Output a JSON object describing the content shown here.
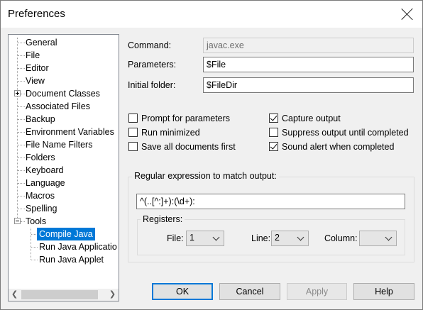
{
  "window": {
    "title": "Preferences"
  },
  "tree": {
    "items": [
      "General",
      "File",
      "Editor",
      "View",
      "Document Classes",
      "Associated Files",
      "Backup",
      "Environment Variables",
      "File Name Filters",
      "Folders",
      "Keyboard",
      "Language",
      "Macros",
      "Spelling",
      "Tools",
      "Compile Java",
      "Run Java Applicatio",
      "Run Java Applet"
    ],
    "selected": "Compile Java"
  },
  "form": {
    "command_label": "Command:",
    "command_value": "javac.exe",
    "parameters_label": "Parameters:",
    "parameters_value": "$File",
    "initial_folder_label": "Initial folder:",
    "initial_folder_value": "$FileDir"
  },
  "options": {
    "prompt": {
      "label": "Prompt for parameters",
      "checked": false
    },
    "minimized": {
      "label": "Run minimized",
      "checked": false
    },
    "save_all": {
      "label": "Save all documents first",
      "checked": false
    },
    "capture": {
      "label": "Capture output",
      "checked": true
    },
    "suppress": {
      "label": "Suppress output until completed",
      "checked": false
    },
    "sound": {
      "label": "Sound alert when completed",
      "checked": true
    }
  },
  "regex": {
    "group_label": "Regular expression to match output:",
    "value": "^(..[^:]+):(\\d+):",
    "registers_label": "Registers:",
    "file_label": "File:",
    "file_value": "1",
    "line_label": "Line:",
    "line_value": "2",
    "column_label": "Column:",
    "column_value": ""
  },
  "buttons": {
    "ok": "OK",
    "cancel": "Cancel",
    "apply": "Apply",
    "help": "Help"
  }
}
